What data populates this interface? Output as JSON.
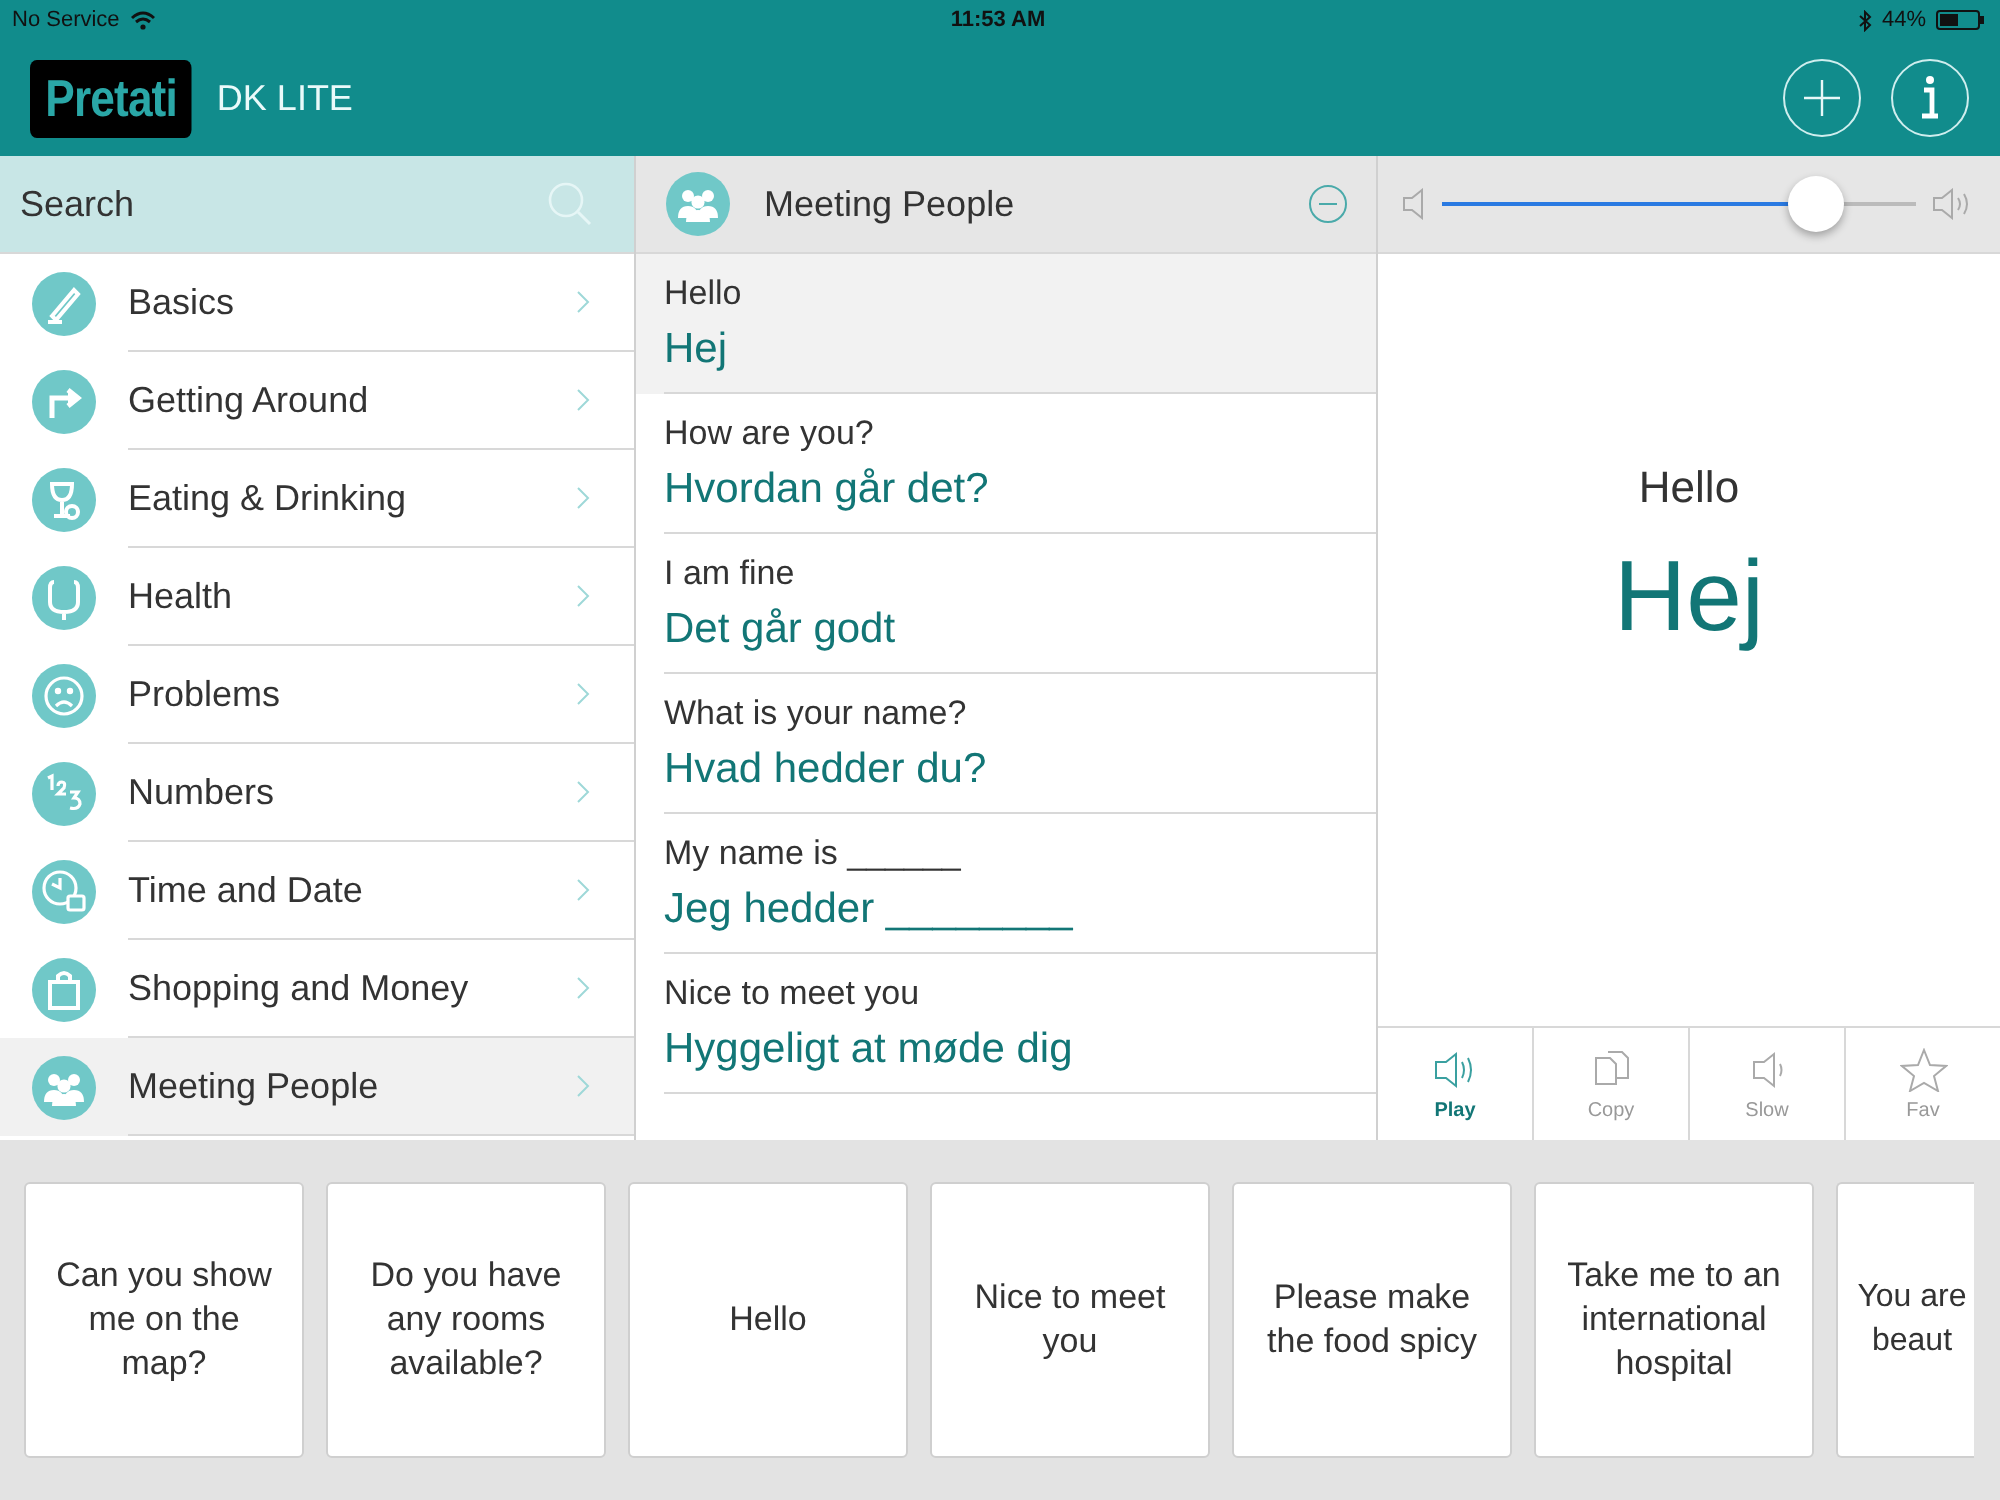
{
  "status_bar": {
    "carrier": "No Service",
    "time": "11:53 AM",
    "battery": "44%"
  },
  "header": {
    "logo": "Pretati",
    "title": "DK LITE"
  },
  "search": {
    "placeholder": "Search"
  },
  "categories": [
    {
      "label": "Basics",
      "selected": false
    },
    {
      "label": "Getting Around",
      "selected": false
    },
    {
      "label": "Eating & Drinking",
      "selected": false
    },
    {
      "label": "Health",
      "selected": false
    },
    {
      "label": "Problems",
      "selected": false
    },
    {
      "label": "Numbers",
      "selected": false
    },
    {
      "label": "Time and Date",
      "selected": false
    },
    {
      "label": "Shopping and Money",
      "selected": false
    },
    {
      "label": "Meeting People",
      "selected": true
    }
  ],
  "phrase_list": {
    "title": "Meeting People",
    "items": [
      {
        "english": "Hello",
        "danish": "Hej",
        "selected": true
      },
      {
        "english": "How are you?",
        "danish": "Hvordan går det?",
        "selected": false
      },
      {
        "english": "I am fine",
        "danish": "Det går godt",
        "selected": false
      },
      {
        "english": "What is your name?",
        "danish": "Hvad hedder du?",
        "selected": false
      },
      {
        "english": "My name is ______",
        "danish": "Jeg hedder ________",
        "selected": false
      },
      {
        "english": "Nice to meet you",
        "danish": "Hyggeligt at møde dig",
        "selected": false
      }
    ]
  },
  "volume": {
    "level": 0.79
  },
  "detail": {
    "english": "Hello",
    "danish": "Hej"
  },
  "actions": [
    {
      "label": "Play",
      "selected": true
    },
    {
      "label": "Copy",
      "selected": false
    },
    {
      "label": "Slow",
      "selected": false
    },
    {
      "label": "Fav",
      "selected": false
    }
  ],
  "favorites": [
    "Can you show me on the map?",
    "Do you have any rooms available?",
    "Hello",
    "Nice to meet you",
    "Please make the food spicy",
    "Take me to an international hospital",
    "You are beaut"
  ]
}
